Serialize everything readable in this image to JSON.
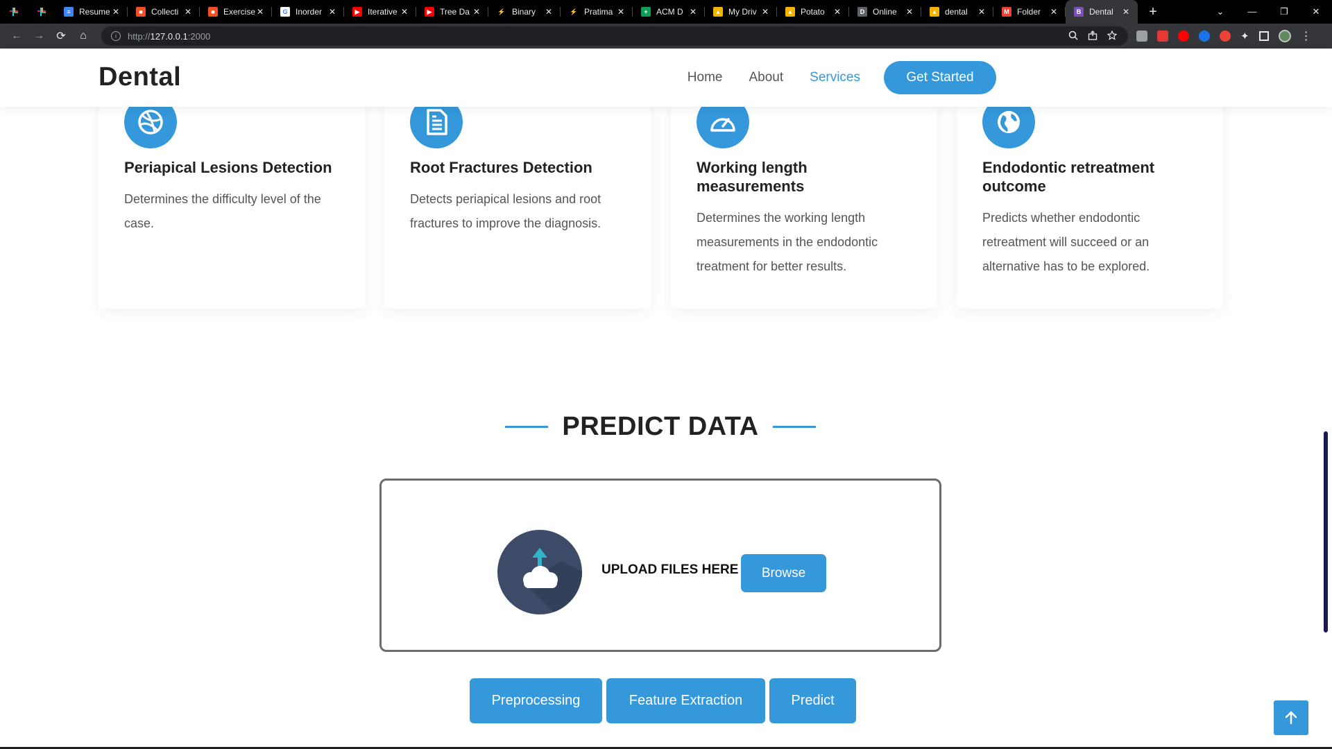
{
  "browser": {
    "tabs": [
      {
        "title": "Resume",
        "favicon_color": "#4285f4",
        "favicon_glyph": "≡"
      },
      {
        "title": "Collecti",
        "favicon_color": "#f25022",
        "favicon_glyph": "■"
      },
      {
        "title": "Exercise",
        "favicon_color": "#f25022",
        "favicon_glyph": "■"
      },
      {
        "title": "Inorder",
        "favicon_color": "#ffffff",
        "favicon_glyph": "G"
      },
      {
        "title": "Iterative",
        "favicon_color": "#ff0000",
        "favicon_glyph": "▶"
      },
      {
        "title": "Tree Da",
        "favicon_color": "#ff0000",
        "favicon_glyph": "▶"
      },
      {
        "title": "Binary",
        "favicon_color": "#000000",
        "favicon_glyph": "⚡"
      },
      {
        "title": "Pratima",
        "favicon_color": "#000000",
        "favicon_glyph": "⚡"
      },
      {
        "title": "ACM D",
        "favicon_color": "#0f9d58",
        "favicon_glyph": "+"
      },
      {
        "title": "My Driv",
        "favicon_color": "#f4b400",
        "favicon_glyph": "▲"
      },
      {
        "title": "Potato",
        "favicon_color": "#f4b400",
        "favicon_glyph": "▲"
      },
      {
        "title": "Online",
        "favicon_color": "#5f6368",
        "favicon_glyph": "D"
      },
      {
        "title": "dental",
        "favicon_color": "#f4b400",
        "favicon_glyph": "▲"
      },
      {
        "title": "Folder",
        "favicon_color": "#ea4335",
        "favicon_glyph": "M"
      },
      {
        "title": "Dental",
        "favicon_color": "#7952b3",
        "favicon_glyph": "B",
        "active": true
      }
    ],
    "new_tab": "+",
    "close_glyph": "✕",
    "window_controls": {
      "minimize": "—",
      "restore": "❐",
      "close": "✕"
    },
    "nav": {
      "back": "←",
      "forward": "→",
      "reload": "⟳",
      "home": "⌂"
    },
    "url_prefix": "http://",
    "url_host": "127.0.0.1",
    "url_port": ":2000"
  },
  "site": {
    "logo": "Dental",
    "nav": {
      "home": "Home",
      "about": "About",
      "services": "Services",
      "get_started": "Get Started"
    }
  },
  "services": [
    {
      "icon": "dribbble-icon",
      "title": "Periapical Lesions Detection",
      "description": "Determines the difficulty level of the case."
    },
    {
      "icon": "file-text-icon",
      "title": "Root Fractures Detection",
      "description": "Detects periapical lesions and root fractures to improve the diagnosis."
    },
    {
      "icon": "speedometer-icon",
      "title": "Working length measurements",
      "description": "Determines the working length measurements in the endodontic treatment for better results."
    },
    {
      "icon": "globe-icon",
      "title": "Endodontic retreatment outcome",
      "description": "Predicts whether endodontic retreatment will succeed or an alternative has to be explored."
    }
  ],
  "predict": {
    "title": "PREDICT DATA",
    "upload_text": "UPLOAD FILES HERE",
    "browse": "Browse",
    "actions": {
      "preprocessing": "Preprocessing",
      "feature_extraction": "Feature Extraction",
      "predict": "Predict"
    }
  },
  "colors": {
    "accent": "#3498db",
    "heading": "#222222",
    "body_text": "#555555",
    "cloud_bg": "#3d4b68"
  }
}
